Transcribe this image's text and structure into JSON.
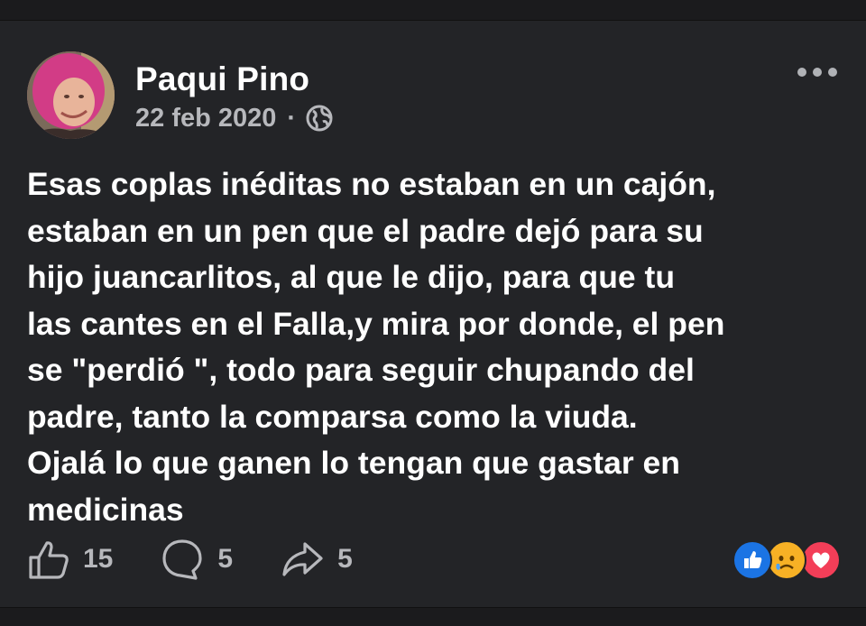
{
  "post": {
    "author": "Paqui Pino",
    "date": "22 feb 2020",
    "separator": "·",
    "privacy_icon": "globe-icon",
    "text": "Esas coplas inéditas no estaban en un cajón,\nestaban en un pen que el padre dejó para su\nhijo juancarlitos,  al que le dijo, para que tu\nlas cantes en el Falla,y mira por donde, el pen\nse \"perdió \", todo para seguir chupando del\npadre, tanto la comparsa como la viuda.\nOjalá lo que ganen lo tengan que gastar en\nmedicinas"
  },
  "actions": {
    "likes": "15",
    "comments": "5",
    "shares": "5"
  },
  "reactions": [
    "like-reaction-icon",
    "sad-reaction-icon",
    "love-reaction-icon"
  ],
  "colors": {
    "background": "#232427",
    "text": "#ffffff",
    "muted": "#b7b8bc",
    "like_blue": "#1b74e4",
    "love_red": "#f33e58",
    "sad_yellow": "#f7b125"
  }
}
